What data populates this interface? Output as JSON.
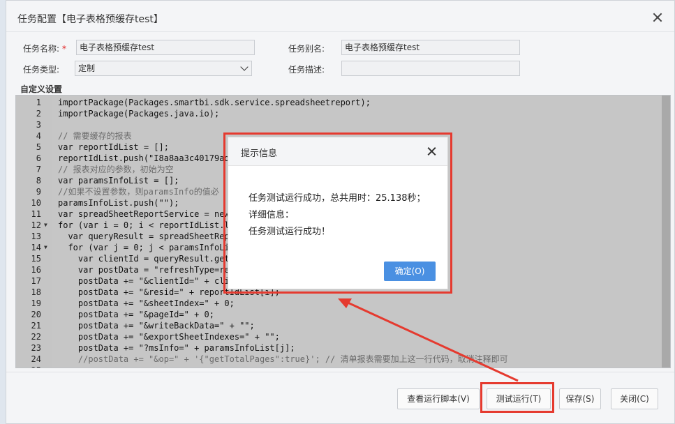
{
  "dialog": {
    "title": "任务配置【电子表格预缓存test】",
    "section_title": "自定义设置"
  },
  "form": {
    "name_label": "任务名称:",
    "required_mark": "*",
    "name_value": "电子表格预缓存test",
    "alias_label": "任务别名:",
    "alias_value": "电子表格预缓存test",
    "type_label": "任务类型:",
    "type_value": "定制",
    "desc_label": "任务描述:",
    "desc_value": ""
  },
  "editor": {
    "lines": [
      {
        "n": "1",
        "text": "importPackage(Packages.smartbi.sdk.service.spreadsheetreport);",
        "cls": ""
      },
      {
        "n": "2",
        "text": "importPackage(Packages.java.io);",
        "cls": ""
      },
      {
        "n": "3",
        "text": "",
        "cls": ""
      },
      {
        "n": "4",
        "text": "// 需要缓存的报表",
        "cls": "cm"
      },
      {
        "n": "5",
        "text": "var reportIdList = [];",
        "cls": ""
      },
      {
        "n": "6",
        "text": "reportIdList.push(\"I8a8aa3c40179ad8",
        "cls": ""
      },
      {
        "n": "7",
        "text": "// 报表对应的参数，初始为空",
        "cls": "cm"
      },
      {
        "n": "8",
        "text": "var paramsInfoList = [];",
        "cls": ""
      },
      {
        "n": "9",
        "text": "//如果不设置参数，则paramsInfo的值必",
        "cls": "cm"
      },
      {
        "n": "10",
        "text": "paramsInfoList.push(\"\");",
        "cls": ""
      },
      {
        "n": "11",
        "text": "var spreadSheetReportService = new S",
        "cls": ""
      },
      {
        "n": "12",
        "text": "for (var i = 0; i < reportIdList.le",
        "cls": "",
        "fold": true
      },
      {
        "n": "13",
        "text": "  var queryResult = spreadSheetRepo",
        "cls": ""
      },
      {
        "n": "14",
        "text": "  for (var j = 0; j < paramsInfoLis",
        "cls": "",
        "fold": true
      },
      {
        "n": "15",
        "text": "    var clientId = queryResult.get(",
        "cls": ""
      },
      {
        "n": "16",
        "text": "    var postData = \"refreshType=ref",
        "cls": ""
      },
      {
        "n": "17",
        "text": "    postData += \"&clientId=\" + clie",
        "cls": ""
      },
      {
        "n": "18",
        "text": "    postData += \"&resid=\" + reportIdList[i];",
        "cls": ""
      },
      {
        "n": "19",
        "text": "    postData += \"&sheetIndex=\" + 0;",
        "cls": ""
      },
      {
        "n": "20",
        "text": "    postData += \"&pageId=\" + 0;",
        "cls": ""
      },
      {
        "n": "21",
        "text": "    postData += \"&writeBackData=\" + \"\";",
        "cls": ""
      },
      {
        "n": "22",
        "text": "    postData += \"&exportSheetIndexes=\" + \"\";",
        "cls": ""
      },
      {
        "n": "23",
        "text": "    postData += \"?msInfo=\" + paramsInfoList[j];",
        "cls": ""
      },
      {
        "n": "24",
        "text": "    //postData += \"&op=\" + '{\"getTotalPages\":true}'; // 清单报表需要加上这一行代码，取消注释即可",
        "cls": "cm"
      },
      {
        "n": "25",
        "text": "",
        "cls": ""
      }
    ]
  },
  "buttons": {
    "view_script": "查看运行脚本(V)",
    "test_run": "测试运行(T)",
    "save": "保存(S)",
    "close": "关闭(C)"
  },
  "modal": {
    "title": "提示信息",
    "line1": "任务测试运行成功，总共用时：25.138秒；",
    "line2": "详细信息：",
    "line3": "任务测试运行成功！",
    "ok": "确定(O)"
  },
  "colors": {
    "annotation": "#e53a2f",
    "primary": "#4a90e2"
  }
}
